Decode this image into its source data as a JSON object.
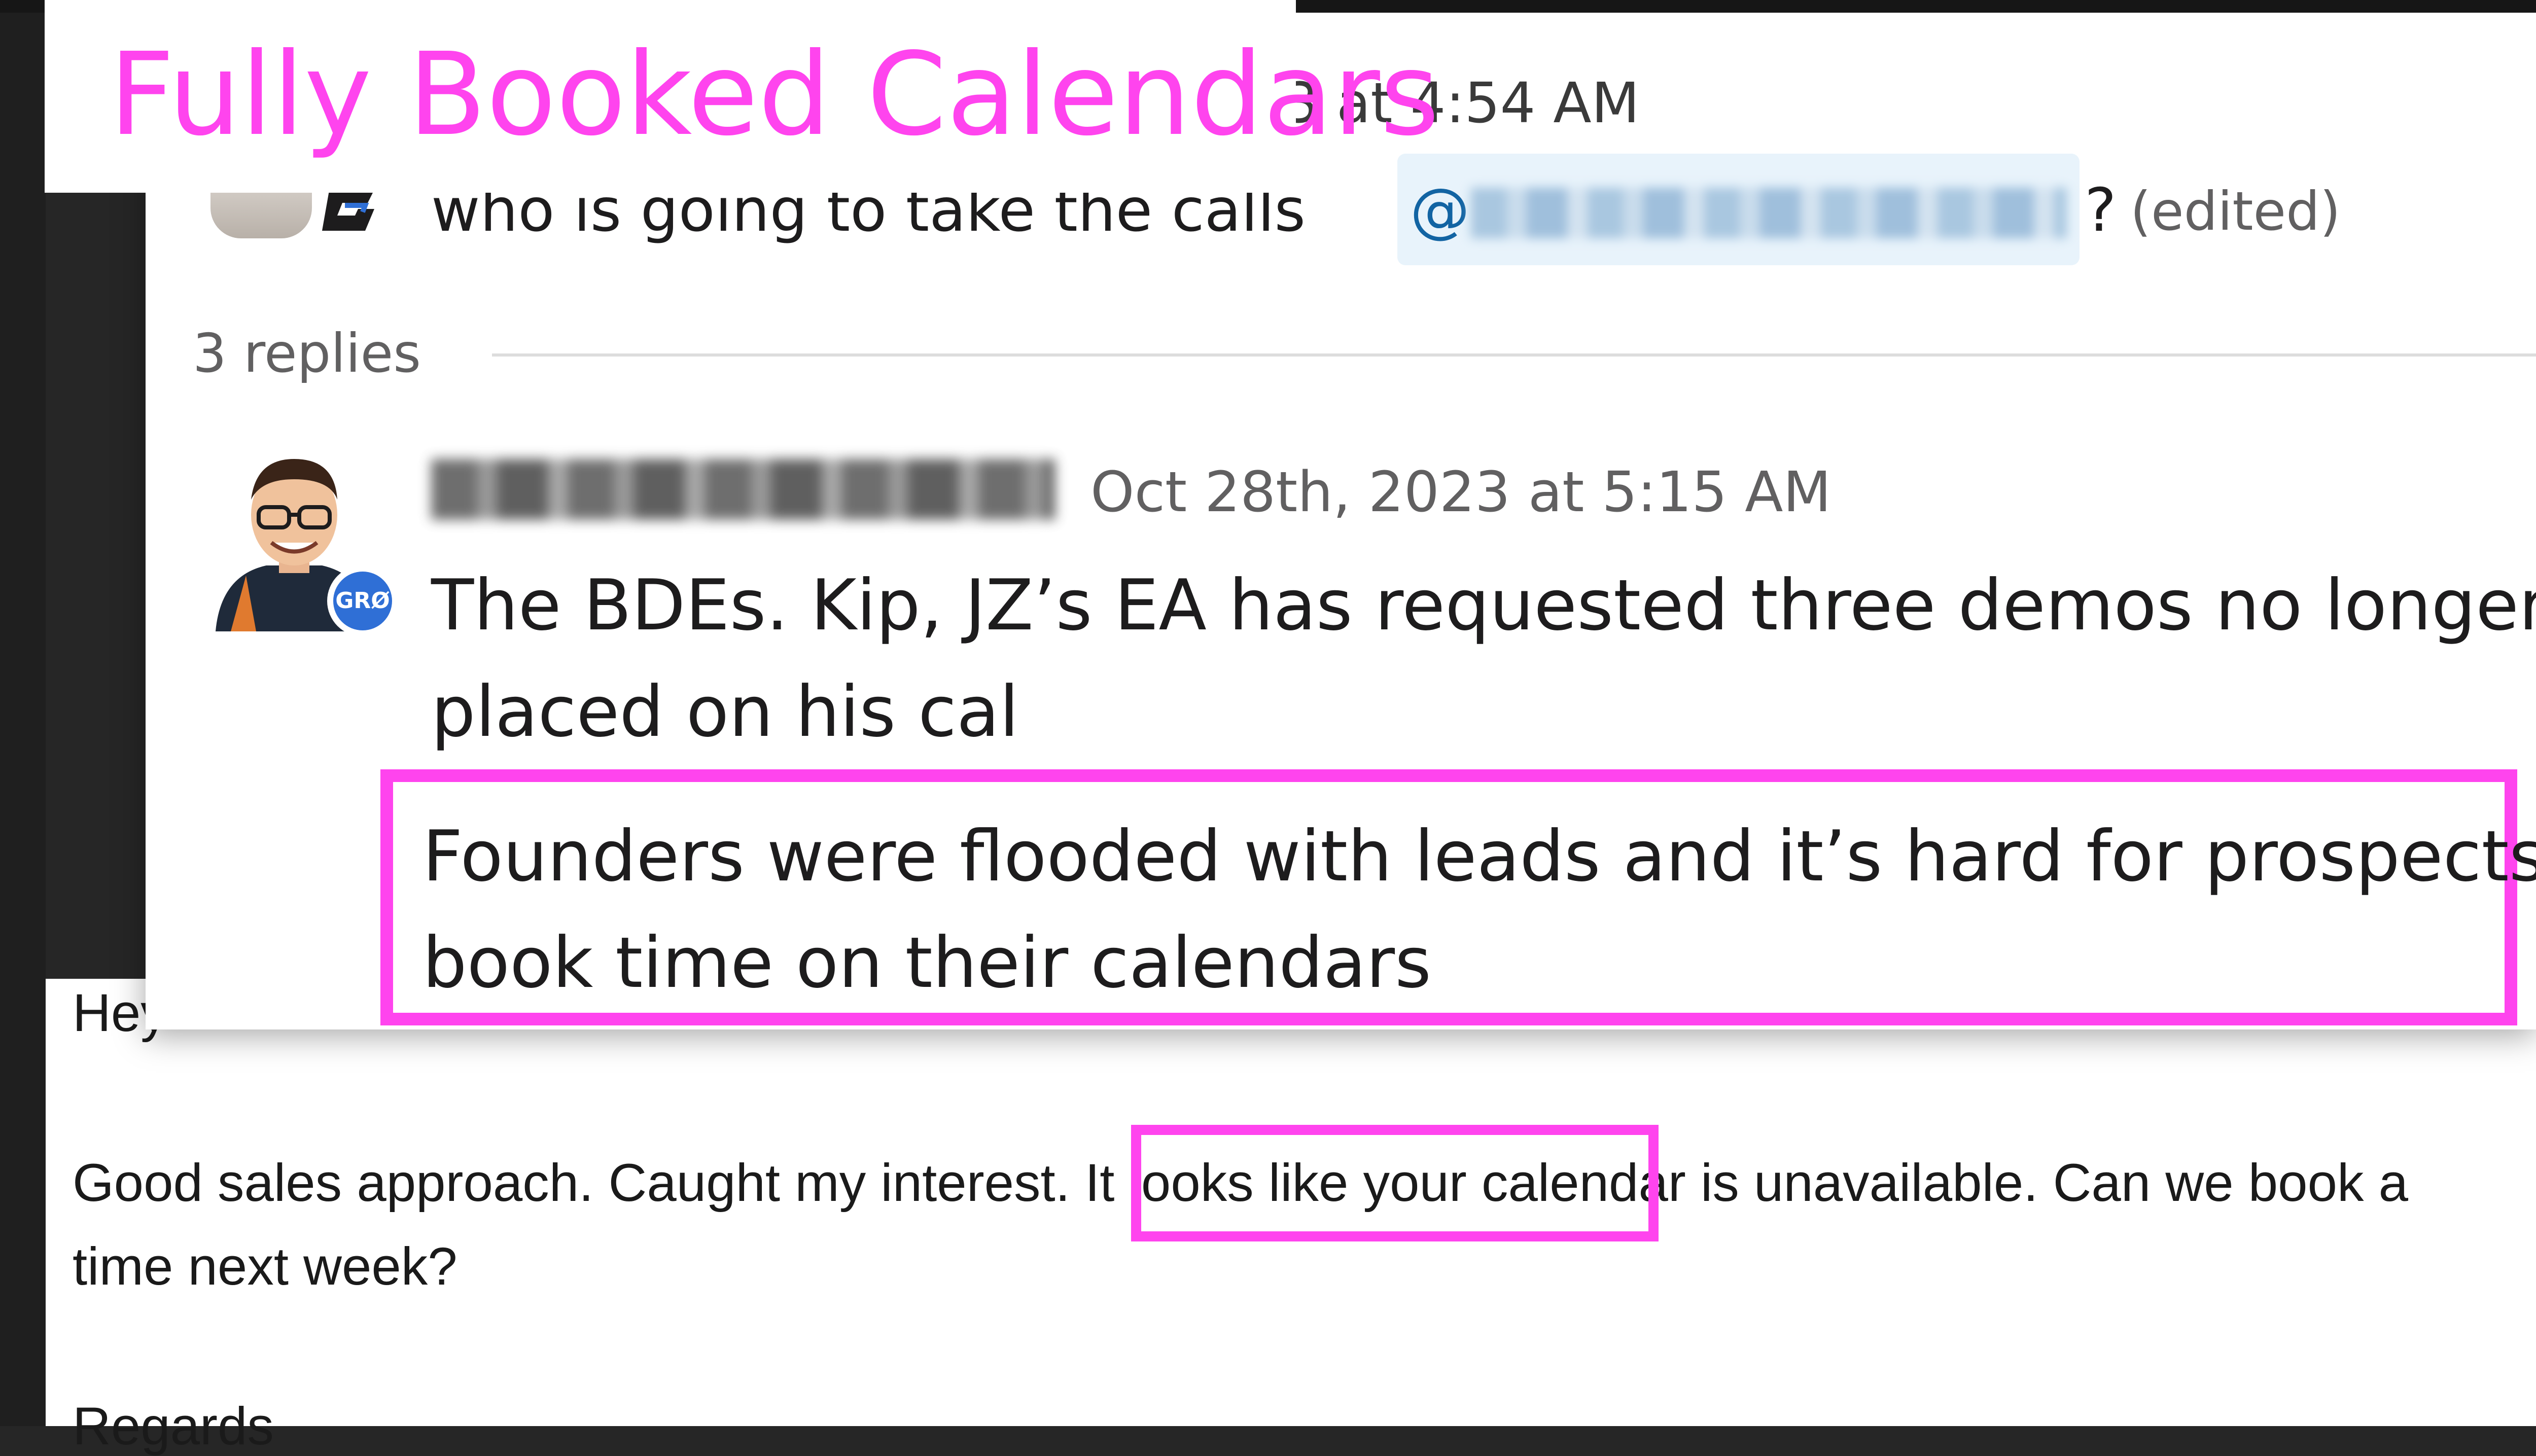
{
  "title": "Fully Booked Calendars",
  "slack": {
    "top_message": {
      "timestamp_fragment": "3 at 4:54 AM",
      "text": "who is going to take the calls",
      "mention_prefix": "@",
      "suffix": "?",
      "edited_label": "(edited)"
    },
    "replies_count_label": "3 replies",
    "reply": {
      "timestamp": "Oct 28th, 2023 at 5:15 AM",
      "badge": "GRØ",
      "line1": "The BDEs. Kip, JZ’s EA has requested three demos no longer be",
      "line2": "placed on his cal",
      "highlight_line1": "Founders were flooded with leads and it’s hard for prospects to",
      "highlight_line2": "book time on their calendars"
    }
  },
  "email": {
    "greeting": "Hey",
    "line1_a": "Good sales approach. Caught my interest. ",
    "line1_highlight": "It looks like your calendar is unavailable.",
    "line1_b": " Can we book a",
    "line2": "time next week?",
    "signoff": "Regards"
  },
  "colors": {
    "highlight": "#ff44ee",
    "mention_bg": "#e8f3fb",
    "mention_text": "#1264a3",
    "badge_blue": "#2f6fd6"
  }
}
